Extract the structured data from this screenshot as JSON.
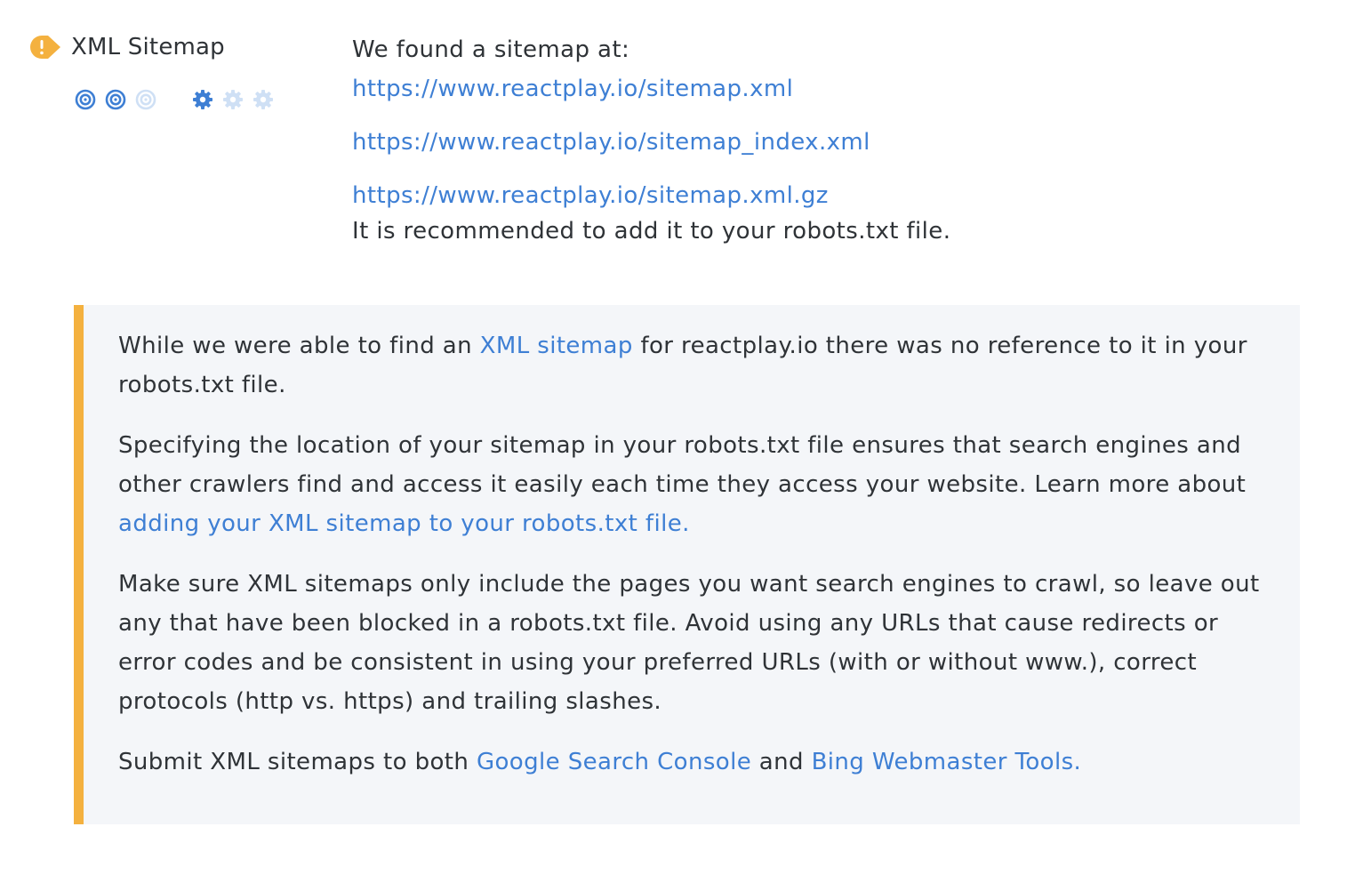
{
  "section": {
    "title": "XML Sitemap",
    "status_icon": "warning-exclamation-icon",
    "colors": {
      "warning": "#f4b13f",
      "link": "#3e7fd4",
      "icon_active": "#3e7fd4",
      "icon_inactive": "#cfe0f5",
      "callout_bg": "#f4f6f9"
    },
    "importance": {
      "icon": "target-icon",
      "level": 2,
      "max": 3
    },
    "difficulty": {
      "icon": "gear-icon",
      "level": 1,
      "max": 3
    }
  },
  "result": {
    "intro": "We found a sitemap at:",
    "sitemaps": [
      "https://www.reactplay.io/sitemap.xml",
      "https://www.reactplay.io/sitemap_index.xml",
      "https://www.reactplay.io/sitemap.xml.gz"
    ],
    "recommendation": "It is recommended to add it to your robots.txt file."
  },
  "callout": {
    "p1": {
      "before": "While we were able to find an ",
      "link": "XML sitemap",
      "after": " for reactplay.io there was no reference to it in your robots.txt file."
    },
    "p2": {
      "before": "Specifying the location of your sitemap in your robots.txt file ensures that search engines and other crawlers find and access it easily each time they access your website. Learn more about ",
      "link": "adding your XML sitemap to your robots.txt file."
    },
    "p3": "Make sure XML sitemaps only include the pages you want search engines to crawl, so leave out any that have been blocked in a robots.txt file. Avoid using any URLs that cause redirects or error codes and be consistent in using your preferred URLs (with or without www.), correct protocols (http vs. https) and trailing slashes.",
    "p4": {
      "before": "Submit XML sitemaps to both ",
      "link1": "Google Search Console",
      "middle": " and ",
      "link2": "Bing Webmaster Tools."
    }
  }
}
